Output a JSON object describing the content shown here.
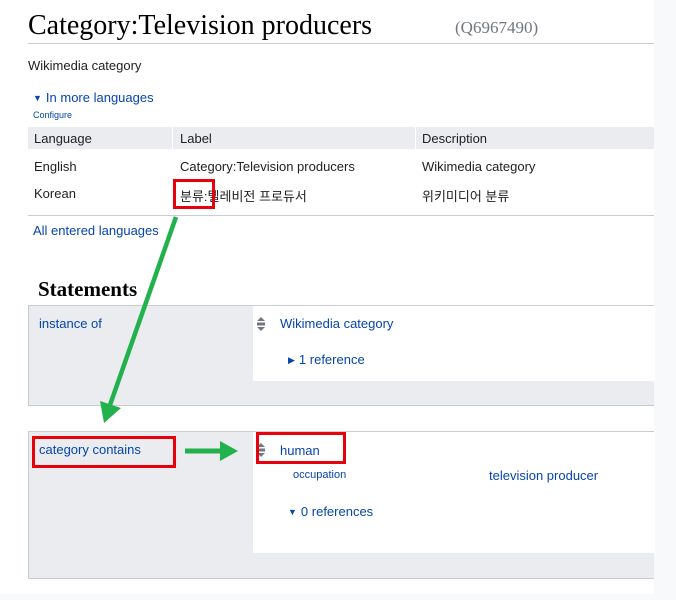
{
  "page": {
    "title": "Category:Television producers",
    "qid": "(Q6967490)",
    "description": "Wikimedia category"
  },
  "languages": {
    "toggle_label": "In more languages",
    "configure_label": "Configure",
    "headers": [
      "Language",
      "Label",
      "Description"
    ],
    "rows": [
      [
        "English",
        "Category:Television producers",
        "Wikimedia category"
      ],
      [
        "Korean",
        "분류:텔레비전 프로듀서",
        "위키미디어 분류"
      ]
    ],
    "all_entered_label": "All entered languages"
  },
  "statements": {
    "heading": "Statements",
    "groups": [
      {
        "property": "instance of",
        "value": "Wikimedia category",
        "references_label": "1 reference"
      },
      {
        "property": "category contains",
        "value": "human",
        "qualifier_property": "occupation",
        "qualifier_value": "television producer",
        "references_label": "0 references"
      }
    ]
  },
  "annotations": {
    "highlight_color": "#e8000b",
    "arrow_color": "#22b14c"
  },
  "icons": {
    "toggle": "triangle-down-icon",
    "reference_toggle": "triangle-right-icon",
    "rank": "normal-rank-icon"
  }
}
